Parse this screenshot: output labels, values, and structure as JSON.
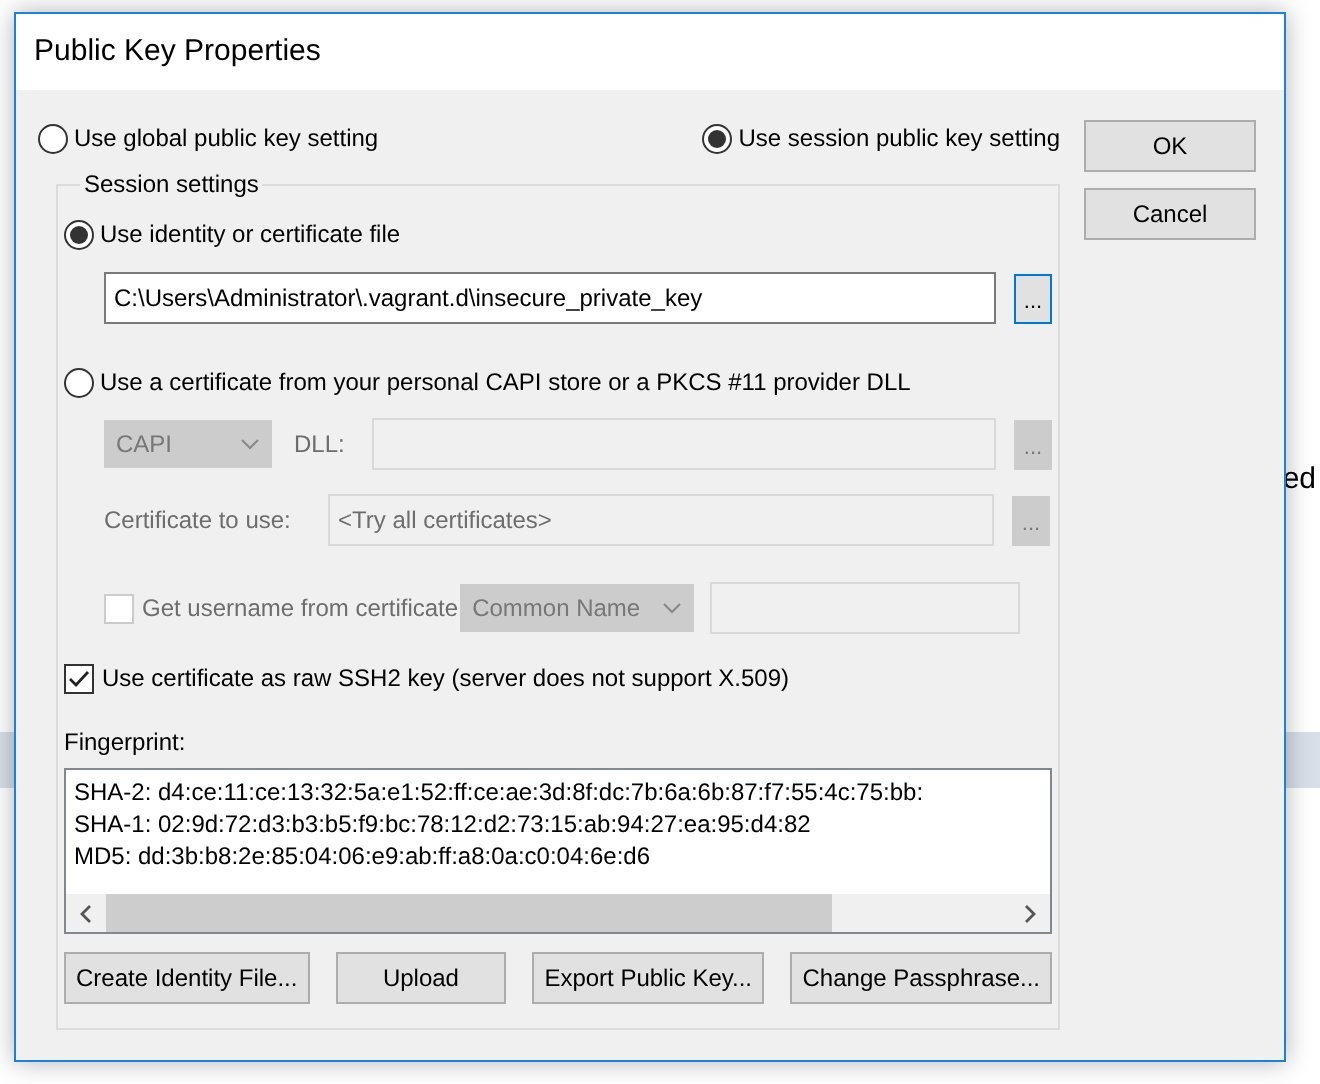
{
  "background_text": "ed",
  "window": {
    "title": "Public Key Properties"
  },
  "mode_options": [
    {
      "label": "Use global public key setting",
      "selected": false
    },
    {
      "label": "Use session public key setting",
      "selected": true
    }
  ],
  "dialog_buttons": [
    "OK",
    "Cancel"
  ],
  "session_settings": {
    "title": "Session settings",
    "source_options": [
      {
        "label": "Use identity or certificate file",
        "selected": true
      },
      {
        "label": "Use a certificate from your personal CAPI store or a PKCS #11 provider DLL",
        "selected": false
      }
    ],
    "identity_file": {
      "value": "C:\\Users\\Administrator\\.vagrant.d\\insecure_private_key",
      "browse": "..."
    },
    "certificate_store": {
      "disabled": true,
      "store": "CAPI",
      "dll_label": "DLL:",
      "dll_browse": "...",
      "certificate_label": "Certificate to use:",
      "certificate_value": "<Try all certificates>",
      "certificate_browse": "...",
      "username_label": "Get username from certificate",
      "username_checked": false,
      "username_field": "Common Name"
    },
    "raw_ssh2": {
      "label": "Use certificate as raw SSH2 key (server does not support X.509)",
      "checked": true
    },
    "fingerprint": {
      "label": "Fingerprint:",
      "lines": [
        "SHA-2: d4:ce:11:ce:13:32:5a:e1:52:ff:ce:ae:3d:8f:dc:7b:6a:6b:87:f7:55:4c:75:bb:",
        "SHA-1: 02:9d:72:d3:b3:b5:f9:bc:78:12:d2:73:15:ab:94:27:ea:95:d4:82",
        "MD5: dd:3b:b8:2e:85:04:06:e9:ab:ff:a8:0a:c0:04:6e:d6"
      ]
    },
    "buttons": [
      "Create Identity File...",
      "Upload",
      "Export Public Key...",
      "Change Passphrase..."
    ]
  }
}
